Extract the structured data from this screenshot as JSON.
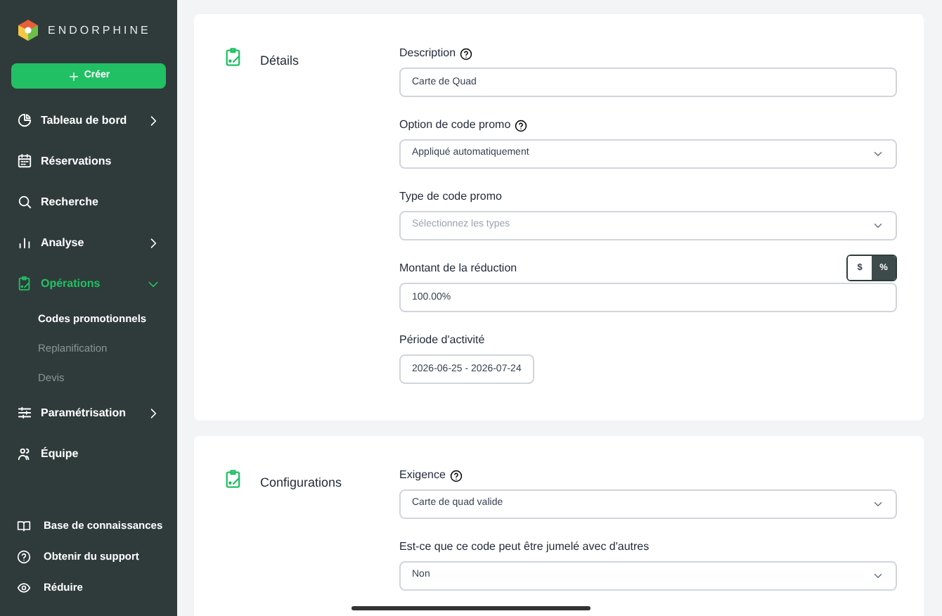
{
  "brand": {
    "name": "ENDORPHINE"
  },
  "create_button": {
    "label": "Créer"
  },
  "nav": [
    {
      "label": "Tableau de bord",
      "selected": false,
      "has_arrow": true
    },
    {
      "label": "Réservations",
      "selected": false
    },
    {
      "label": "Recherche",
      "selected": false
    },
    {
      "label": "Analyse",
      "selected": false,
      "has_arrow": true
    },
    {
      "label": "Opérations",
      "selected": true,
      "has_arrow": true,
      "expanded": true,
      "children": [
        {
          "label": "Codes promotionnels",
          "selected": true
        },
        {
          "label": "Replanification",
          "selected": false
        },
        {
          "label": "Devis",
          "selected": false
        }
      ]
    },
    {
      "label": "Paramétrisation",
      "selected": false,
      "has_arrow": true
    },
    {
      "label": "Équipe",
      "selected": false
    }
  ],
  "footer_nav": [
    {
      "label": "Base de connaissances"
    },
    {
      "label": "Obtenir du support"
    },
    {
      "label": "Réduire"
    }
  ],
  "sections": [
    {
      "title": "Détails",
      "fields": [
        {
          "kind": "text",
          "label": "Description",
          "help": true,
          "value": "Carte de Quad"
        },
        {
          "kind": "select",
          "label": "Option de code promo",
          "help": true,
          "value": "Appliqué automatiquement"
        },
        {
          "kind": "select",
          "label": "Type de code promo",
          "help": false,
          "placeholder": "Sélectionnez les types"
        },
        {
          "kind": "amount",
          "label": "Montant de la réduction",
          "help": false,
          "value": "100.00%",
          "units": [
            {
              "label": "$",
              "selected": false
            },
            {
              "label": "%",
              "selected": true
            }
          ]
        },
        {
          "kind": "date",
          "label": "Période d'activité",
          "help": false,
          "value": "2026-06-25 - 2026-07-24"
        }
      ]
    },
    {
      "title": "Configurations",
      "fields": [
        {
          "kind": "select",
          "label": "Exigence",
          "help": true,
          "value": "Carte de quad valide"
        },
        {
          "kind": "select",
          "label": "Est-ce que ce code peut être jumelé avec d'autres",
          "help": false,
          "value": "Non"
        }
      ]
    }
  ]
}
